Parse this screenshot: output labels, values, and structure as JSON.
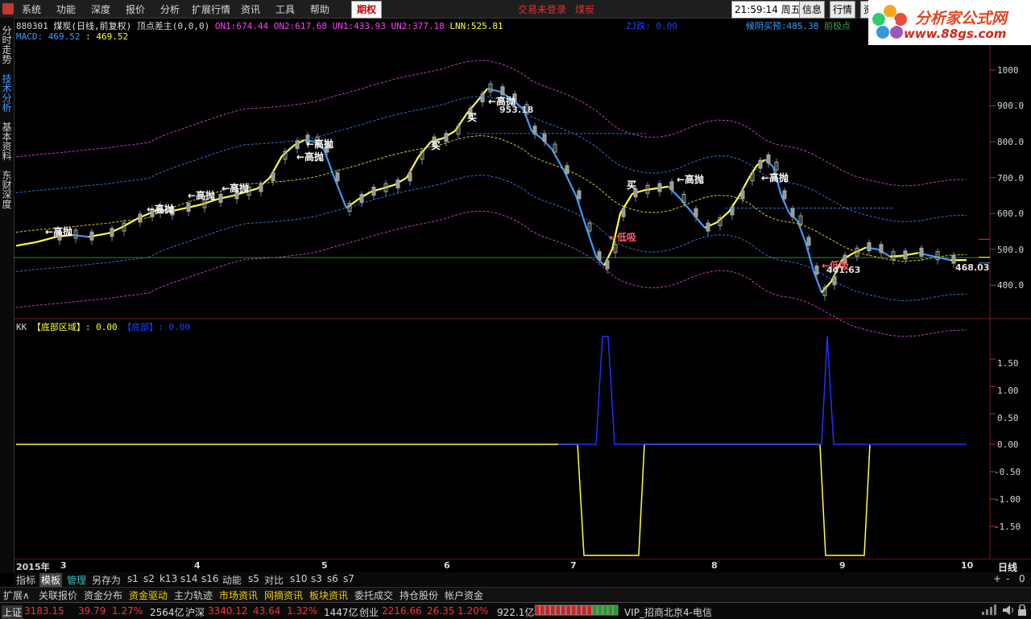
{
  "menu": {
    "items": [
      "系统",
      "功能",
      "深度",
      "报价",
      "分析",
      "扩展行情",
      "资讯",
      "工具",
      "帮助"
    ],
    "active": "期权",
    "trade_status": "交易未登录",
    "stock_name": "煤炭",
    "clock": "21:59:14",
    "weekday": "周五",
    "right_buttons": [
      "信息",
      "行情",
      "资"
    ]
  },
  "logo": {
    "title": "分析家公式网",
    "url": "www.88gs.com"
  },
  "left_tabs": [
    "分时走势",
    "技术分析",
    "基本资料",
    "东财深度"
  ],
  "main_chart": {
    "header": {
      "code": "880301",
      "name": "煤炭(日线,前复权)",
      "indicator": "顶点差主(0,0,0)",
      "items": [
        {
          "label": "ON1:",
          "value": "674.44",
          "color": "#ff40ff"
        },
        {
          "label": "ON2:",
          "value": "617.68",
          "color": "#ff40ff"
        },
        {
          "label": "UN1:",
          "value": "433.93",
          "color": "#ff40ff"
        },
        {
          "label": "UN2:",
          "value": "377.18",
          "color": "#ff40ff"
        },
        {
          "label": "LNN:",
          "value": "525.81",
          "color": "#ffff40"
        },
        {
          "label": "ZJ跌:",
          "value": "0.00",
          "color": "#2040ff"
        }
      ],
      "right_items": [
        {
          "label": "候阴买预:",
          "value": "485.38",
          "color": "#3b9bff"
        },
        {
          "label": "前极点",
          "value": "",
          "color": "#40a040"
        }
      ]
    },
    "macd_line": {
      "label": "MACD:",
      "value1": "469.52",
      "value2": "469.52"
    },
    "y_ticks": [
      "1000",
      "900.0",
      "800.0",
      "700.0",
      "600.0",
      "500.0",
      "400.0"
    ],
    "annotations": {
      "high_sell": "高抛",
      "low_buy": "低吸",
      "high_price": "953.18",
      "low_price": "441.63",
      "last_price": "468.03",
      "buy_marker": "买"
    }
  },
  "sub_chart": {
    "header": {
      "name": "KK",
      "item1_label": "【底部区域】:",
      "item1_value": "0.00",
      "item2_label": "【底部】:",
      "item2_value": "0.00"
    },
    "y_ticks": [
      "1.50",
      "1.00",
      "0.50",
      "0.00",
      "-0.50",
      "-1.00",
      "-1.50"
    ]
  },
  "x_axis": {
    "year": "2015年",
    "months": [
      "3",
      "4",
      "5",
      "6",
      "7",
      "8",
      "9",
      "10"
    ],
    "period": "日线"
  },
  "tab_row1": [
    "指标",
    "模板",
    "管理",
    "另存为",
    "s1",
    "s2",
    "k13",
    "s14",
    "s16",
    "动能",
    "s5",
    "对比",
    "s10",
    "s3",
    "s6",
    "s7"
  ],
  "tab_row1_right": [
    "+",
    "-",
    "0"
  ],
  "tab_row2": [
    "扩展∧",
    "关联报价",
    "资金分布",
    "资金驱动",
    "主力轨迹",
    "市场资讯",
    "网摘资讯",
    "板块资讯",
    "委托成交",
    "持仓股份",
    "帐户资金"
  ],
  "tab_row2_highlight": [
    "资金驱动",
    "市场资讯",
    "网摘资讯",
    "板块资讯"
  ],
  "ticker": {
    "sh_label": "上证",
    "sh_value": "3183.15",
    "sh_change": "39.79",
    "sh_pct": "1.27%",
    "sh_amount": "2564亿",
    "hs_label": "沪深",
    "hs_value": "3340.12",
    "hs_change": "43.64",
    "hs_pct": "1.32%",
    "hs_amount": "1447亿",
    "cy_label": "创业",
    "cy_value": "2216.66",
    "cy_change": "26.35",
    "cy_pct": "1.20%",
    "cy_amount": "922.1亿",
    "server": "VIP_招商北京4-电信"
  }
}
